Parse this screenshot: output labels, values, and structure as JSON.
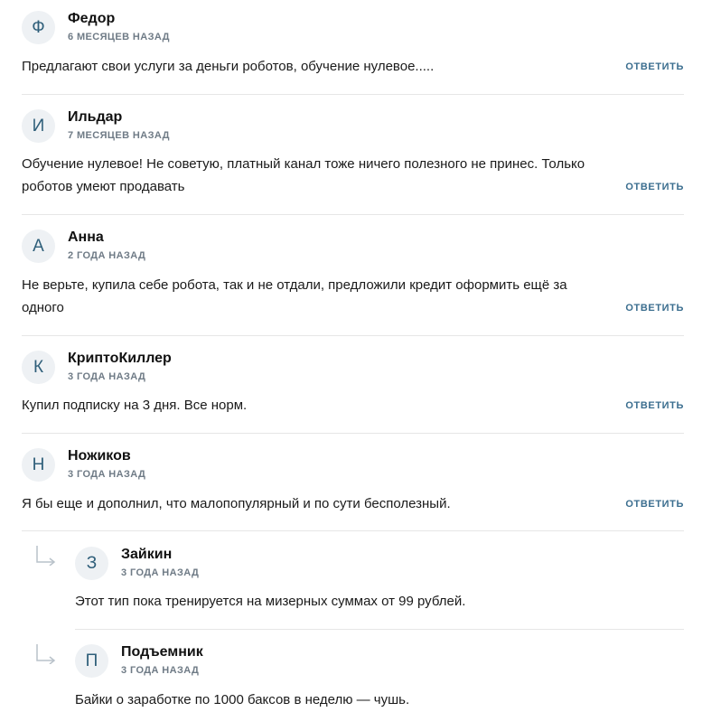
{
  "comments": [
    {
      "initial": "Ф",
      "name": "Федор",
      "time": "6 МЕСЯЦЕВ НАЗАД",
      "text": "Предлагают свои услуги за деньги роботов, обучение нулевое.....",
      "reply_label": "ОТВЕТИТЬ"
    },
    {
      "initial": "И",
      "name": "Ильдар",
      "time": "7 МЕСЯЦЕВ НАЗАД",
      "text": "Обучение нулевое! Не советую, платный канал тоже ничего полезного не принес. Только роботов умеют продавать",
      "reply_label": "ОТВЕТИТЬ"
    },
    {
      "initial": "А",
      "name": "Анна",
      "time": "2 ГОДА НАЗАД",
      "text": "Не верьте, купила себе робота, так и не отдали, предложили кредит оформить ещё за одного",
      "reply_label": "ОТВЕТИТЬ"
    },
    {
      "initial": "К",
      "name": "КриптоКиллер",
      "time": "3 ГОДА НАЗАД",
      "text": "Купил подписку на 3 дня. Все норм.",
      "reply_label": "ОТВЕТИТЬ"
    },
    {
      "initial": "Н",
      "name": "Ножиков",
      "time": "3 ГОДА НАЗАД",
      "text": "Я бы еще и дополнил, что малопопулярный и по сути бесполезный.",
      "reply_label": "ОТВЕТИТЬ"
    }
  ],
  "replies": [
    {
      "initial": "З",
      "name": "Зайкин",
      "time": "3 ГОДА НАЗАД",
      "text": "Этот тип пока тренируется на мизерных суммах от 99 рублей."
    },
    {
      "initial": "П",
      "name": "Подъемник",
      "time": "3 ГОДА НАЗАД",
      "text": "Байки о заработке по 1000 баксов в неделю — чушь."
    }
  ],
  "colors": {
    "accent": "#3b6e8f",
    "avatar_bg": "#eef1f4",
    "divider": "#e6e6e6"
  }
}
